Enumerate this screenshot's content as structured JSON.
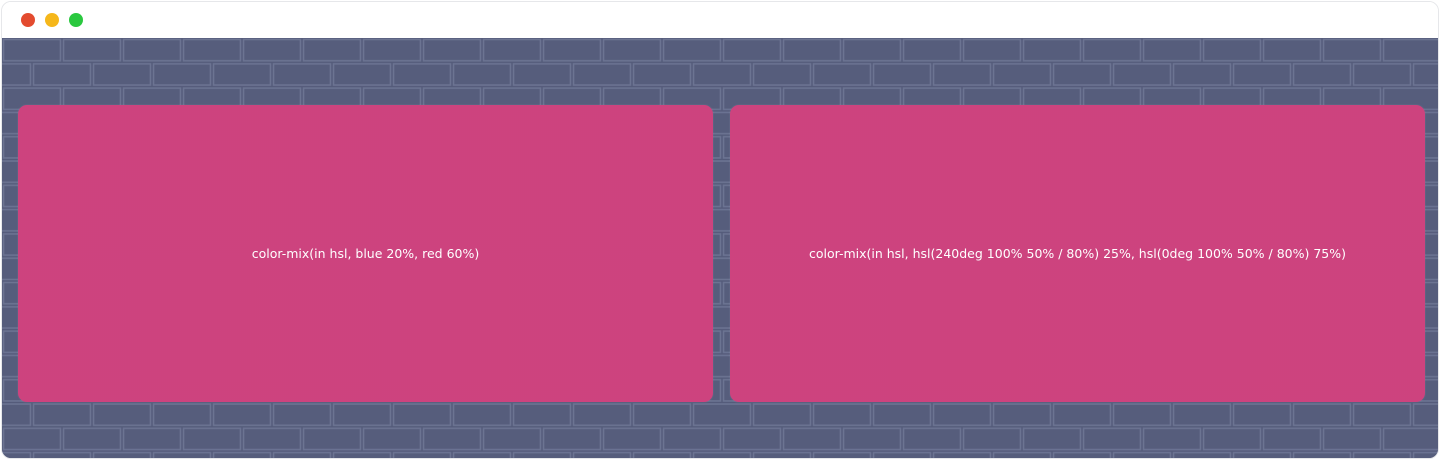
{
  "window": {
    "controls": {
      "close_color": "#e34b2f",
      "minimize_color": "#f5b71b",
      "maximize_color": "#2ac83f"
    }
  },
  "page": {
    "background_color": "#545b7a",
    "brick_joint_color": "#8a92b2"
  },
  "panels": [
    {
      "label": "color-mix(in hsl, blue 20%, red 60%)",
      "color": "#cc3f7c"
    },
    {
      "label": "color-mix(in hsl, hsl(240deg 100% 50% / 80%) 25%, hsl(0deg 100% 50% / 80%) 75%)",
      "color": "#cc3f7c"
    }
  ]
}
